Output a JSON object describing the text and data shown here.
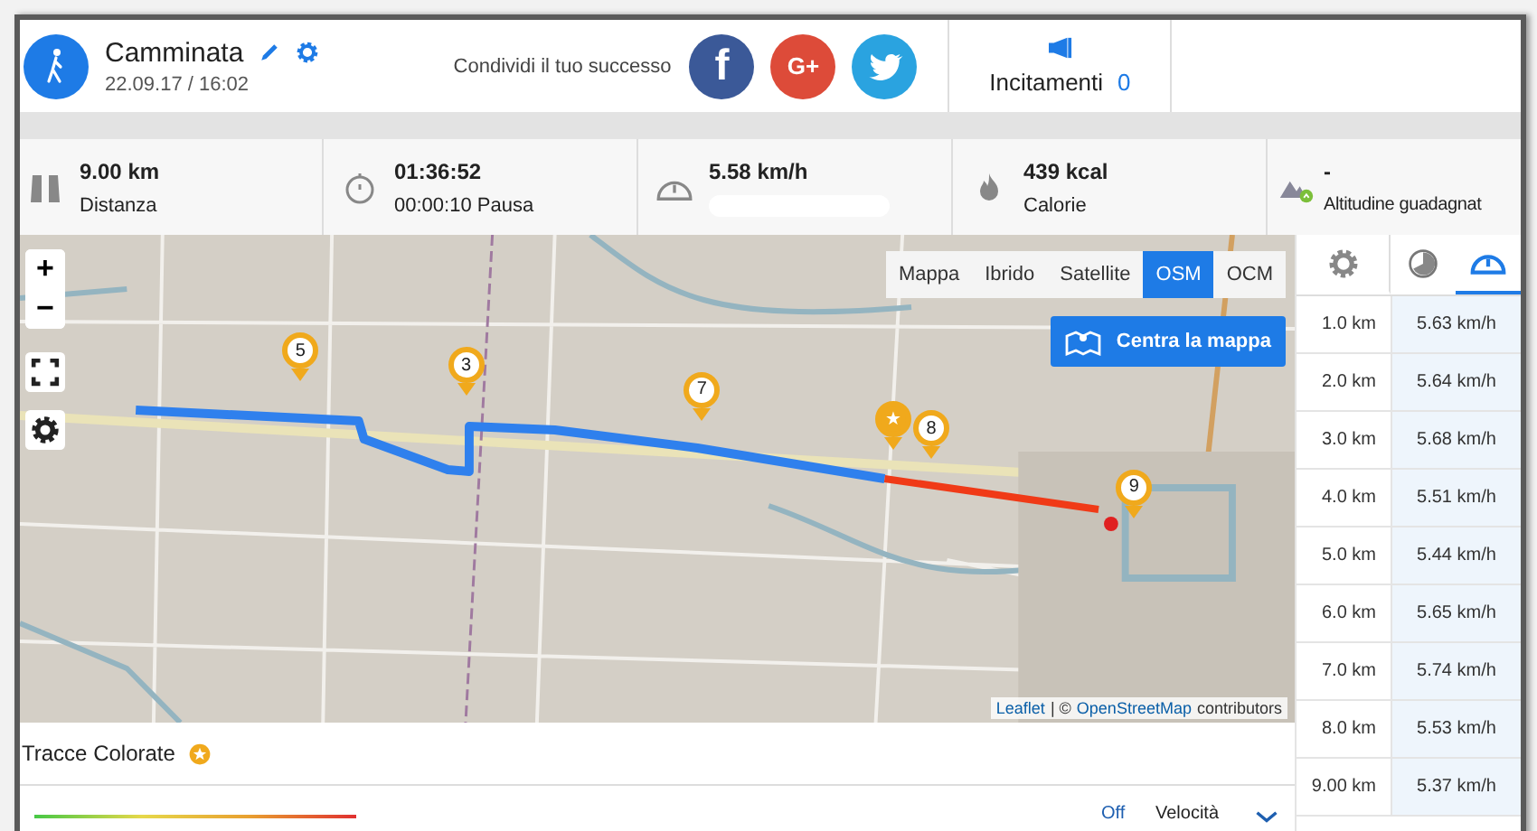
{
  "header": {
    "title": "Camminata",
    "date": "22.09.17 / 16:02",
    "share_label": "Condividi il tuo successo",
    "share": [
      {
        "kind": "facebook",
        "label": "f",
        "color": "#3b5998"
      },
      {
        "kind": "google",
        "label": "G+",
        "color": "#dd4b39"
      },
      {
        "kind": "twitter",
        "color": "#2aa3e0"
      }
    ],
    "cheers": {
      "label": "Incitamenti",
      "count": "0"
    }
  },
  "stats": [
    {
      "kind": "distance",
      "value": "9.00 km",
      "label": "Distanza"
    },
    {
      "kind": "time",
      "value": "01:36:52",
      "label": "00:00:10 Pausa"
    },
    {
      "kind": "speed",
      "value": "5.58 km/h"
    },
    {
      "kind": "calories",
      "value": "439 kcal",
      "label": "Calorie"
    },
    {
      "kind": "altitude",
      "value": "-",
      "label": "Altitudine guadagnat"
    }
  ],
  "map": {
    "zoom_in": "+",
    "zoom_out": "−",
    "layers": [
      {
        "label": "Mappa",
        "selected": false
      },
      {
        "label": "Ibrido",
        "selected": false
      },
      {
        "label": "Satellite",
        "selected": false
      },
      {
        "label": "OSM",
        "selected": true
      },
      {
        "label": "OCM",
        "selected": false
      }
    ],
    "center_button": "Centra la mappa",
    "markers": [
      {
        "kind": "number",
        "label": "5"
      },
      {
        "kind": "number",
        "label": "3"
      },
      {
        "kind": "number",
        "label": "7"
      },
      {
        "kind": "star",
        "label": "★"
      },
      {
        "kind": "number",
        "label": "8"
      },
      {
        "kind": "number",
        "label": "9"
      }
    ],
    "attribution": {
      "link1": "Leaflet",
      "separator": "| ©",
      "link2": "OpenStreetMap",
      "rest": "contributors"
    }
  },
  "splits": {
    "tabs": [
      {
        "kind": "settings",
        "selected": false
      },
      {
        "kind": "time",
        "selected": false
      },
      {
        "kind": "speed",
        "selected": true
      }
    ],
    "rows": [
      {
        "distance": "1.0 km",
        "speed": "5.63 km/h"
      },
      {
        "distance": "2.0 km",
        "speed": "5.64 km/h"
      },
      {
        "distance": "3.0 km",
        "speed": "5.68 km/h"
      },
      {
        "distance": "4.0 km",
        "speed": "5.51 km/h"
      },
      {
        "distance": "5.0 km",
        "speed": "5.44 km/h"
      },
      {
        "distance": "6.0 km",
        "speed": "5.65 km/h"
      },
      {
        "distance": "7.0 km",
        "speed": "5.74 km/h"
      },
      {
        "distance": "8.0 km",
        "speed": "5.53 km/h"
      },
      {
        "distance": "9.00 km",
        "speed": "5.37 km/h"
      }
    ]
  },
  "colored_tracks": {
    "title": "Tracce Colorate",
    "toggle": "Off",
    "metric": "Velocità"
  }
}
